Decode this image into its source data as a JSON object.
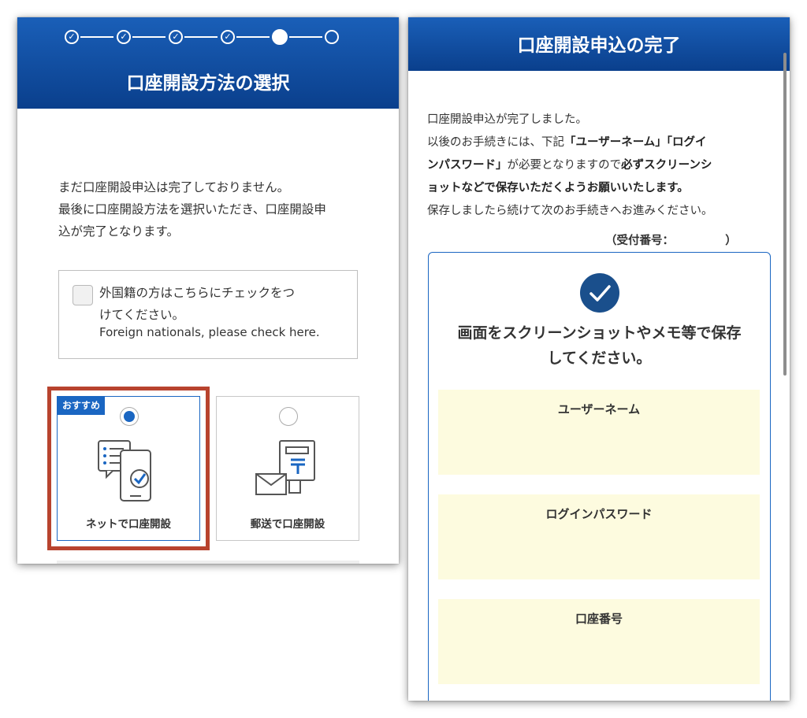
{
  "left": {
    "title": "口座開設方法の選択",
    "steps": [
      "done",
      "done",
      "done",
      "done",
      "current",
      "pending"
    ],
    "intro": [
      "まだ口座開設申込は完了しておりません。",
      "最後に口座開設方法を選択いただき、口座開設申",
      "込が完了となります。"
    ],
    "foreign": {
      "label_ja": [
        "外国籍の方はこちらにチェックをつ",
        "けてください。"
      ],
      "label_en": "Foreign nationals, please check here.",
      "checked": false
    },
    "options": [
      {
        "badge": "おすすめ",
        "label": "ネットで口座開設",
        "selected": true,
        "icon": "phone-document-check-icon"
      },
      {
        "label": "郵送で口座開設",
        "selected": false,
        "icon": "mail-envelope-post-icon"
      }
    ]
  },
  "right": {
    "title": "口座開設申込の完了",
    "intro_line1": "口座開設申込が完了しました。",
    "intro_line2a": "以後のお手続きには、下記",
    "intro_line2b": "「ユーザーネーム」「ログイ",
    "intro_line3a": "ンパスワード」",
    "intro_line3b": "が必要となりますので",
    "intro_line3c": "必ずスクリーンシ",
    "intro_line4": "ョットなどで保存いただくようお願いいたします。",
    "intro_line5": "保存しましたら続けて次のお手続きへお進みください。",
    "receipt": "（受付番号：　　　　　）",
    "result_title": [
      "画面をスクリーンショットやメモ等で保存",
      "してください。"
    ],
    "fields": [
      {
        "label": "ユーザーネーム"
      },
      {
        "label": "ログインパスワード"
      },
      {
        "label": "口座番号"
      }
    ]
  },
  "colors": {
    "header": "#0a3f8c",
    "accent": "#1a66c2",
    "highlight": "#b8432e",
    "field_bg": "#fdfbdf"
  }
}
